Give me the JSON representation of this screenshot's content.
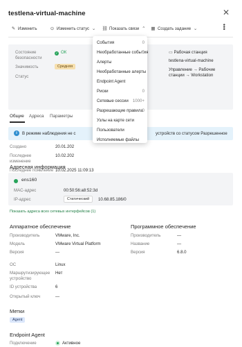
{
  "header": {
    "title": "testlena-virtual-machine"
  },
  "toolbar": {
    "edit": "Изменить",
    "change_status": "Изменить статус",
    "show_links": "Показать связи",
    "create_task": "Создать задание"
  },
  "summary": {
    "status_security_label": "Состояние безопасности",
    "status_security_value": "ОК",
    "significance_label": "Значимость",
    "significance_value": "Средняя",
    "status_label": "Статус",
    "status_value": "Разрешено",
    "type_value": "Рабочая станция",
    "hostname_value": "testlena-virtual-machine",
    "management_value": "Управление → Рабочие станции → Workstation"
  },
  "tabs": [
    "Общие",
    "Адреса",
    "Параметры"
  ],
  "info_banner": {
    "left": "В режиме наблюдения не с",
    "right": "устройств со статусом Разрешенное"
  },
  "general": [
    {
      "label": "Создано",
      "value": "20.01.202"
    },
    {
      "label": "Последнее изменение",
      "value": "10.02.202"
    },
    {
      "label": "Последнее появление",
      "value": "10.02.2025 11:09:13"
    }
  ],
  "address_section": {
    "title": "Адресная информация",
    "iface_name": "ens160",
    "mac_label": "MAC-адрес",
    "mac_value": "00:50:56:a8:52:3d",
    "ip_label": "IP-адрес",
    "ip_type": "Статический",
    "ip_value": "10.68.85.186/0",
    "show_all_link": "Показать адреса всех сетевых интерфейсов (1)"
  },
  "hardware": {
    "title": "Аппаратное обеспечение",
    "rows": [
      {
        "label": "Производитель",
        "value": "VMware, Inc."
      },
      {
        "label": "Модель",
        "value": "VMware Virtual Platform"
      },
      {
        "label": "Версия",
        "value": "—"
      }
    ]
  },
  "software": {
    "title": "Программное обеспечение",
    "rows": [
      {
        "label": "Производитель",
        "value": "—"
      },
      {
        "label": "Название",
        "value": "—"
      },
      {
        "label": "Версия",
        "value": "6.8.0"
      }
    ]
  },
  "device_more": [
    {
      "label": "ОС",
      "value": "Linux"
    },
    {
      "label": "Маршрутизирующее устройство",
      "value": "Нет"
    },
    {
      "label": "ID устройства",
      "value": "6"
    },
    {
      "label": "Открытый ключ",
      "value": "—"
    }
  ],
  "labels_section": {
    "title": "Метки",
    "tag": "Agent"
  },
  "endpoint_agent": {
    "title": "Endpoint Agent",
    "connection_label": "Подключение",
    "connection_value": "Активное"
  },
  "links_menu": [
    {
      "label": "События",
      "count": "0"
    },
    {
      "label": "Необработанные события",
      "count": "0"
    },
    {
      "label": "Алерты",
      "count": ""
    },
    {
      "label": "Необработанные алерты",
      "count": ""
    },
    {
      "label": "Endpoint Agent",
      "count": ""
    },
    {
      "label": "Риски",
      "count": "0"
    },
    {
      "label": "Сетевые сессии",
      "count": "1000+"
    },
    {
      "label": "Разрешающие правила",
      "count": "0"
    },
    {
      "label": "Узлы на карте сети",
      "count": ""
    },
    {
      "label": "Пользователи",
      "count": ""
    },
    {
      "label": "Исполняемые файлы",
      "count": ""
    }
  ],
  "colors": {
    "ok_green": "#27a35a",
    "info_bg": "#e4f2fb",
    "link_green": "#1f7e44",
    "medium_badge": "#f6dfae"
  }
}
